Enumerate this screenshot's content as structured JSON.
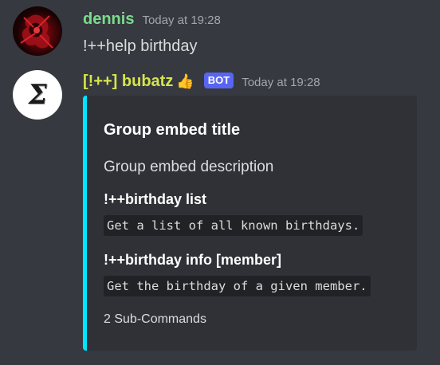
{
  "messages": [
    {
      "username": "dennis",
      "timestamp": "Today at 19:28",
      "content": "!++help birthday",
      "avatar_icon": "dennis-avatar",
      "username_color": "#7bdc8c"
    },
    {
      "username": "[!++] bubatz",
      "emoji": "👍",
      "badge": "BOT",
      "timestamp": "Today at 19:28",
      "avatar_icon": "sigma-logo",
      "username_color": "#d6e54a"
    }
  ],
  "embed": {
    "accent_color": "#00e5ff",
    "title": "Group embed title",
    "description": "Group embed description",
    "fields": [
      {
        "name": "!++birthday list",
        "value": "Get a list of all known birthdays."
      },
      {
        "name": "!++birthday info [member]",
        "value": "Get the birthday of a given member."
      }
    ],
    "footer": "2 Sub-Commands"
  },
  "colors": {
    "background": "#36393f",
    "embed_background": "#2f3136",
    "badge": "#5865f2"
  }
}
